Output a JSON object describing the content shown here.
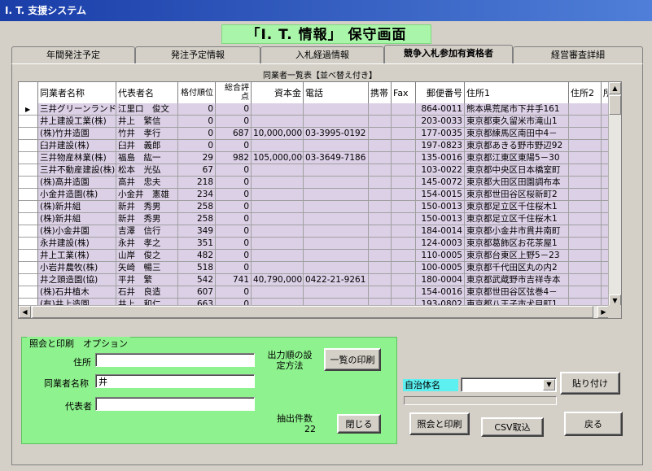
{
  "window": {
    "title": "I. T. 支援システム"
  },
  "heading": "「I. T. 情報」 保守画面",
  "tabs": [
    {
      "label": "年間発注予定"
    },
    {
      "label": "発注予定情報"
    },
    {
      "label": "入札経過情報"
    },
    {
      "label": "競争入札参加有資格者"
    },
    {
      "label": "経営審査詳細"
    }
  ],
  "grid": {
    "caption": "同業者一覧表【並べ替え付き】",
    "columns": [
      "同業者名称",
      "代表者名",
      "格付順位",
      "総合評点",
      "資本金",
      "電話",
      "携帯",
      "Fax",
      "郵便番号",
      "住所1",
      "住所2",
      "所"
    ],
    "rows": [
      [
        "三井グリーンランド",
        "江里口　俊文",
        "0",
        "0",
        "",
        "",
        "",
        "",
        "864-0011",
        "熊本県荒尾市下井手161"
      ],
      [
        "井上建設工業(株)",
        "井上　繁信",
        "0",
        "0",
        "",
        "",
        "",
        "",
        "203-0033",
        "東京都東久留米市滝山1"
      ],
      [
        "(株)竹井造園",
        "竹井　孝行",
        "0",
        "687",
        "10,000,000",
        "03-3995-0192",
        "",
        "",
        "177-0035",
        "東京都練馬区南田中4－"
      ],
      [
        "臼井建設(株)",
        "臼井　義郎",
        "0",
        "0",
        "",
        "",
        "",
        "",
        "197-0823",
        "東京都あきる野市野辺92"
      ],
      [
        "三井物産林業(株)",
        "福島　紘一",
        "29",
        "982",
        "105,000,000",
        "03-3649-7186",
        "",
        "",
        "135-0016",
        "東京都江東区東陽5－30"
      ],
      [
        "三井不動産建設(株)",
        "松本　光弘",
        "67",
        "0",
        "",
        "",
        "",
        "",
        "103-0022",
        "東京都中央区日本橋室町"
      ],
      [
        "(株)高井造園",
        "高井　忠夫",
        "218",
        "0",
        "",
        "",
        "",
        "",
        "145-0072",
        "東京都大田区田園調布本"
      ],
      [
        "小金井造園(株)",
        "小金井　憲雄",
        "234",
        "0",
        "",
        "",
        "",
        "",
        "154-0015",
        "東京都世田谷区桜新町2"
      ],
      [
        "(株)新井組",
        "新井　秀男",
        "258",
        "0",
        "",
        "",
        "",
        "",
        "150-0013",
        "東京都足立区千住桜木1"
      ],
      [
        "(株)新井組",
        "新井　秀男",
        "258",
        "0",
        "",
        "",
        "",
        "",
        "150-0013",
        "東京都足立区千住桜木1"
      ],
      [
        "(株)小金井園",
        "吉澤　信行",
        "349",
        "0",
        "",
        "",
        "",
        "",
        "184-0014",
        "東京都小金井市貫井南町"
      ],
      [
        "永井建設(株)",
        "永井　孝之",
        "351",
        "0",
        "",
        "",
        "",
        "",
        "124-0003",
        "東京都葛飾区お花茶屋1"
      ],
      [
        "井上工業(株)",
        "山岸　俊之",
        "482",
        "0",
        "",
        "",
        "",
        "",
        "110-0005",
        "東京都台東区上野5－23"
      ],
      [
        "小岩井農牧(株)",
        "矢崎　暢三",
        "518",
        "0",
        "",
        "",
        "",
        "",
        "100-0005",
        "東京都千代田区丸の内2"
      ],
      [
        "井之頭造園(協)",
        "平井　繁",
        "542",
        "741",
        "40,790,000",
        "0422-21-9261",
        "",
        "",
        "180-0004",
        "東京都武蔵野市吉祥寺本"
      ],
      [
        "(株)石井植木",
        "石井　良造",
        "607",
        "0",
        "",
        "",
        "",
        "",
        "154-0016",
        "東京都世田谷区弦巻4－"
      ],
      [
        "(有)井上造園",
        "井上　和仁",
        "663",
        "0",
        "",
        "",
        "",
        "",
        "193-0802",
        "東京都八王子市犬目町1"
      ]
    ]
  },
  "options": {
    "group_label": "照会と印刷　オプション",
    "address_label": "住所",
    "address_value": "",
    "company_label": "同業者名称",
    "company_value": "井",
    "rep_label": "代表者",
    "rep_value": "",
    "sort_label": "出力順の設\n定方法",
    "print_list_button": "一覧の印刷",
    "count_label": "抽出件数",
    "count_value": "22",
    "close_button": "閉じる"
  },
  "right_panel": {
    "jichi_label": "自治体名",
    "jichi_value": "",
    "paste_button": "貼り付け",
    "query_print_button": "照会と印刷",
    "csv_button": "CSV取込",
    "back_button": "戻る"
  },
  "colors": {
    "titlebar": "#1a3da8",
    "heading_bg": "#a9f5a9",
    "row_bg": "#dcd0e6",
    "options_bg": "#8ef28e",
    "jichi_bg": "#5cf0f0"
  }
}
